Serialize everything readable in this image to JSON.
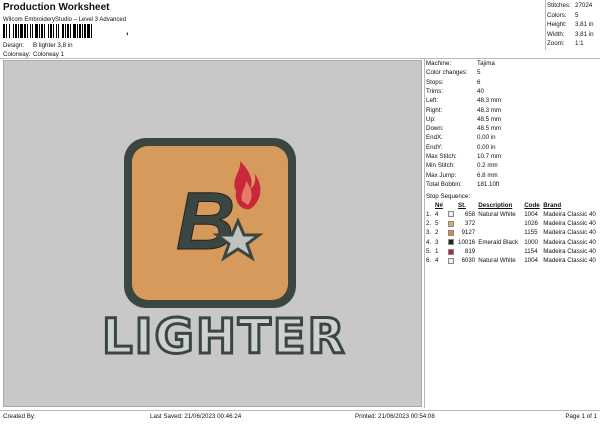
{
  "header": {
    "title": "Production Worksheet",
    "subtitle": "Wilcom EmbroideryStudio – Level 3 Advanced",
    "design_label": "Design:",
    "design_value": "B lighter 3,8 in",
    "colorway_label": "Colorway:",
    "colorway_value": "Colorway 1",
    "barcode_tick": ","
  },
  "summary": [
    {
      "label": "Stitches:",
      "value": "27024"
    },
    {
      "label": "Colors:",
      "value": "5"
    },
    {
      "label": "Height:",
      "value": "3.81 in"
    },
    {
      "label": "Width:",
      "value": "3.81 in"
    },
    {
      "label": "Zoom:",
      "value": "1:1"
    }
  ],
  "machine_info": [
    {
      "label": "Machine:",
      "value": "Tajima"
    },
    {
      "label": "Color changes:",
      "value": "5"
    },
    {
      "label": "Stops:",
      "value": "6"
    },
    {
      "label": "Trims:",
      "value": "40"
    },
    {
      "label": "Left:",
      "value": "48.3 mm"
    },
    {
      "label": "Right:",
      "value": "48.3 mm"
    },
    {
      "label": "Up:",
      "value": "48.5 mm"
    },
    {
      "label": "Down:",
      "value": "48.5 mm"
    },
    {
      "label": "EndX:",
      "value": "0.00 in"
    },
    {
      "label": "EndY:",
      "value": "0.00 in"
    },
    {
      "label": "Max Stitch:",
      "value": "10.7 mm"
    },
    {
      "label": "Min Stitch:",
      "value": "0.2 mm"
    },
    {
      "label": "Max Jump:",
      "value": "6.8 mm"
    },
    {
      "label": "Total Bobbin:",
      "value": "181.10ft"
    }
  ],
  "stop_sequence": {
    "title": "Stop Sequence:",
    "columns": [
      "",
      "N#",
      "",
      "St.",
      "Description",
      "Code",
      "Brand"
    ],
    "rows": [
      {
        "idx": "1.",
        "n": "4",
        "color": "#f2f2ee",
        "st": "658",
        "desc": "Natural White",
        "code": "1004",
        "brand": "Madeira Classic 40"
      },
      {
        "idx": "2.",
        "n": "5",
        "color": "#e0a868",
        "st": "372",
        "desc": "",
        "code": "1026",
        "brand": "Madeira Classic 40"
      },
      {
        "idx": "3.",
        "n": "2",
        "color": "#d9884a",
        "st": "9127",
        "desc": "",
        "code": "1155",
        "brand": "Madeira Classic 40"
      },
      {
        "idx": "4.",
        "n": "3",
        "color": "#1e2a22",
        "st": "10016",
        "desc": "Emerald Black",
        "code": "1000",
        "brand": "Madeira Classic 40"
      },
      {
        "idx": "5.",
        "n": "1",
        "color": "#b0283a",
        "st": "819",
        "desc": "",
        "code": "1154",
        "brand": "Madeira Classic 40"
      },
      {
        "idx": "6.",
        "n": "4",
        "color": "#f2f2ee",
        "st": "6030",
        "desc": "Natural White",
        "code": "1004",
        "brand": "Madeira Classic 40"
      }
    ]
  },
  "design_preview": {
    "logo_letter": "B",
    "word": "LIGHTER",
    "colors": {
      "orange": "#d59a5c",
      "dark": "#3c4640",
      "red": "#c8283a",
      "star": "#bfc4c0",
      "bg": "#c8c8c8"
    }
  },
  "footer": {
    "created_by": "Created By:",
    "last_saved": "Last Saved: 21/06/2023 00:46:24",
    "printed": "Printed: 21/06/2023 00:54:08",
    "page": "Page 1 of 1"
  }
}
